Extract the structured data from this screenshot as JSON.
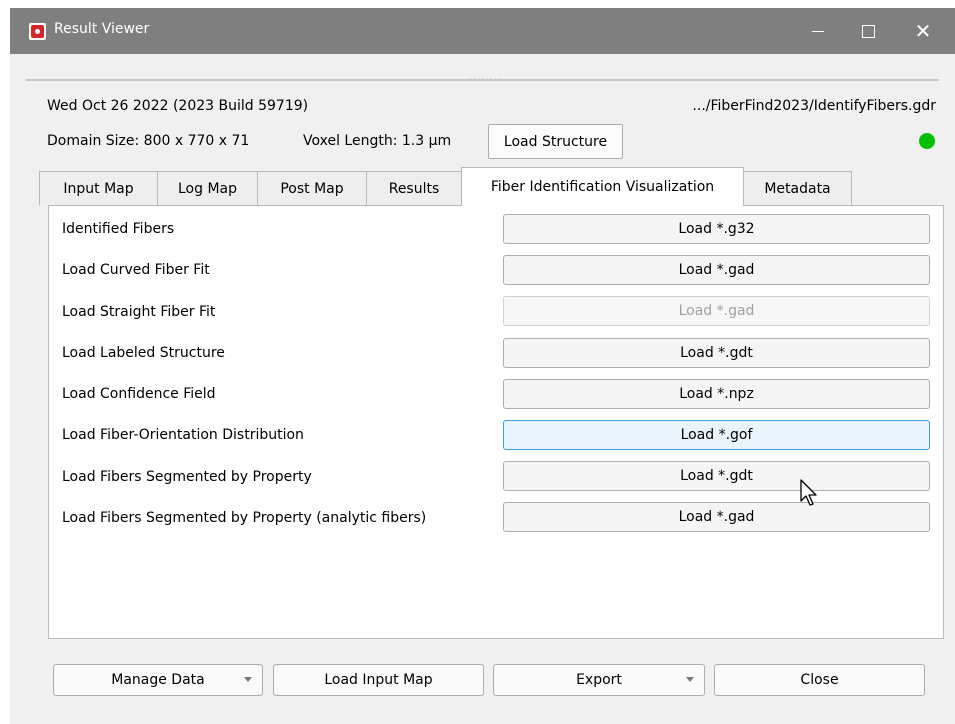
{
  "window": {
    "title": "Result Viewer",
    "controls": {
      "minimize": "",
      "maximize": "",
      "close": "✕"
    }
  },
  "header": {
    "date_build": "Wed Oct 26 2022 (2023 Build 59719)",
    "file_path": ".../FiberFind2023/IdentifyFibers.gdr",
    "domain_size": "Domain Size: 800 x 770 x 71",
    "voxel_length": "Voxel Length: 1.3 μm",
    "load_structure_label": "Load Structure",
    "status_color": "#00c000",
    "grip": "........"
  },
  "tabs": [
    {
      "label": "Input Map"
    },
    {
      "label": "Log Map"
    },
    {
      "label": "Post Map"
    },
    {
      "label": "Results"
    },
    {
      "label": "Fiber Identification Visualization",
      "active": true
    },
    {
      "label": "Metadata"
    }
  ],
  "rows": [
    {
      "label": "Identified Fibers",
      "button": "Load *.g32"
    },
    {
      "label": "Load Curved Fiber Fit",
      "button": "Load *.gad"
    },
    {
      "label": "Load Straight Fiber Fit",
      "button": "Load *.gad",
      "disabled": true
    },
    {
      "label": "Load Labeled Structure",
      "button": "Load *.gdt"
    },
    {
      "label": "Load Confidence Field",
      "button": "Load *.npz"
    },
    {
      "label": "Load Fiber-Orientation Distribution",
      "button": "Load *.gof",
      "focused": true
    },
    {
      "label": "Load Fibers Segmented by Property",
      "button": "Load *.gdt"
    },
    {
      "label": "Load Fibers Segmented by Property (analytic fibers)",
      "button": "Load *.gad"
    }
  ],
  "footer": {
    "manage_data": "Manage Data",
    "load_input_map": "Load Input Map",
    "export": "Export",
    "close": "Close"
  }
}
